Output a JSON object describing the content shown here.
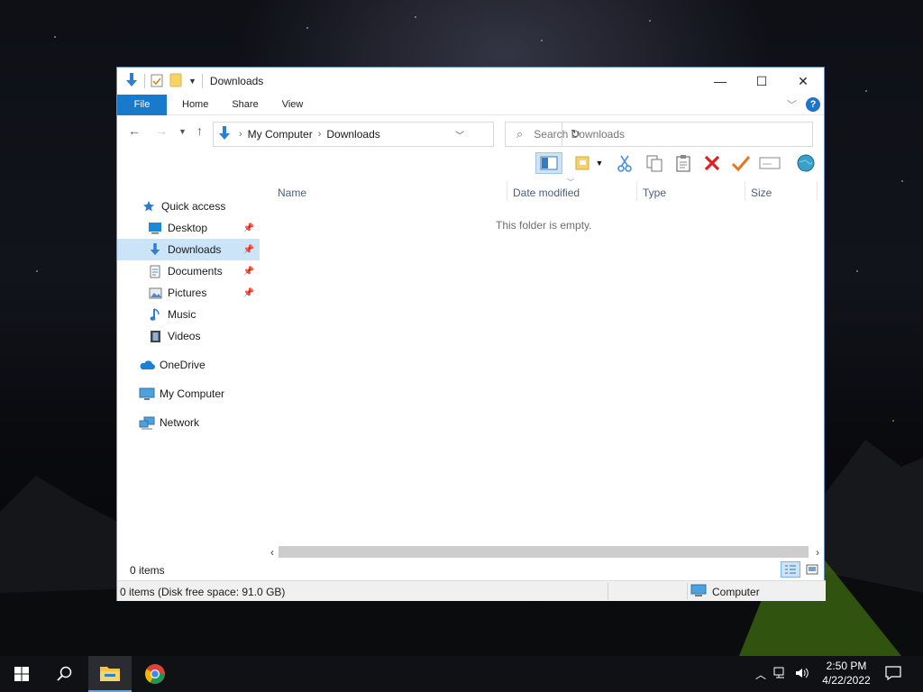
{
  "window": {
    "title": "Downloads",
    "controls": {
      "minimize": "—",
      "maximize": "☐",
      "close": "✕"
    }
  },
  "ribbon": {
    "tabs": [
      {
        "label": "File"
      },
      {
        "label": "Home"
      },
      {
        "label": "Share"
      },
      {
        "label": "View"
      }
    ],
    "help_label": "?"
  },
  "address": {
    "breadcrumbs": [
      "My Computer",
      "Downloads"
    ]
  },
  "search": {
    "placeholder": "Search Downloads"
  },
  "sidebar": {
    "items": [
      {
        "label": "Quick access",
        "icon": "star-icon"
      },
      {
        "label": "Desktop",
        "icon": "desktop-icon",
        "pinned": true
      },
      {
        "label": "Downloads",
        "icon": "download-arrow-icon",
        "pinned": true,
        "selected": true
      },
      {
        "label": "Documents",
        "icon": "document-icon",
        "pinned": true
      },
      {
        "label": "Pictures",
        "icon": "picture-icon",
        "pinned": true
      },
      {
        "label": "Music",
        "icon": "music-note-icon"
      },
      {
        "label": "Videos",
        "icon": "film-icon"
      },
      {
        "label": "OneDrive",
        "icon": "cloud-icon"
      },
      {
        "label": "My Computer",
        "icon": "computer-icon"
      },
      {
        "label": "Network",
        "icon": "network-icon"
      }
    ]
  },
  "filelist": {
    "columns": [
      "Name",
      "Date modified",
      "Type",
      "Size"
    ],
    "empty_message": "This folder is empty."
  },
  "status": {
    "items_count": "0 items",
    "disk_info": "0 items (Disk free space: 91.0 GB)",
    "location": "Computer"
  },
  "taskbar": {
    "time": "2:50 PM",
    "date": "4/22/2022"
  },
  "colors": {
    "accent": "#1979ca",
    "selection": "#cce4f7",
    "taskbar": "#101114"
  }
}
